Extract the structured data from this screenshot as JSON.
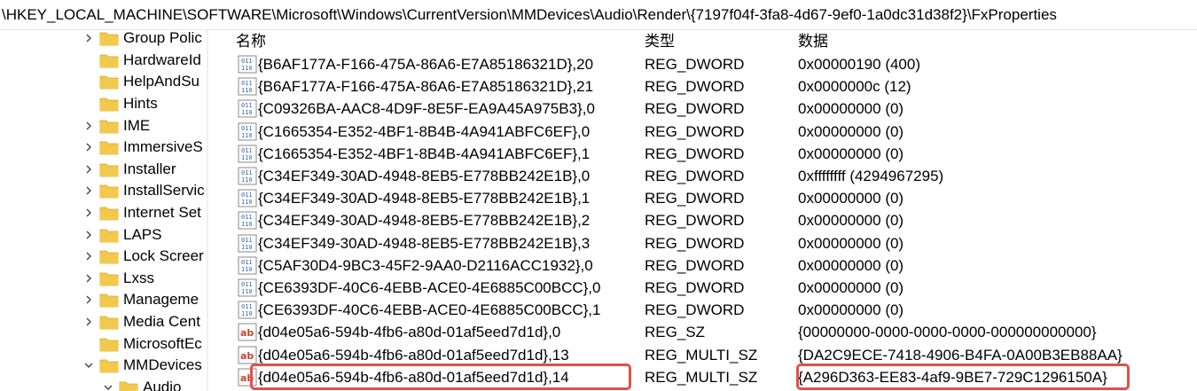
{
  "address": "\\HKEY_LOCAL_MACHINE\\SOFTWARE\\Microsoft\\Windows\\CurrentVersion\\MMDevices\\Audio\\Render\\{7197f04f-3fa8-4d67-9ef0-1a0dc31d38f2}\\FxProperties",
  "tree": {
    "items": [
      {
        "label": "Group Polic",
        "expander": "collapsed"
      },
      {
        "label": "HardwareId",
        "expander": "none"
      },
      {
        "label": "HelpAndSu",
        "expander": "none"
      },
      {
        "label": "Hints",
        "expander": "none"
      },
      {
        "label": "IME",
        "expander": "collapsed"
      },
      {
        "label": "ImmersiveS",
        "expander": "collapsed"
      },
      {
        "label": "Installer",
        "expander": "collapsed"
      },
      {
        "label": "InstallServic",
        "expander": "collapsed"
      },
      {
        "label": "Internet Set",
        "expander": "collapsed"
      },
      {
        "label": "LAPS",
        "expander": "collapsed"
      },
      {
        "label": "Lock Screer",
        "expander": "collapsed"
      },
      {
        "label": "Lxss",
        "expander": "collapsed"
      },
      {
        "label": "Manageme",
        "expander": "collapsed"
      },
      {
        "label": "Media Cent",
        "expander": "collapsed"
      },
      {
        "label": "MicrosoftEc",
        "expander": "none"
      },
      {
        "label": "MMDevices",
        "expander": "expanded"
      },
      {
        "label": "Audio",
        "expander": "expanded"
      }
    ]
  },
  "columns": {
    "name": "名称",
    "type": "类型",
    "data": "数据"
  },
  "rows": [
    {
      "icon": "binary-value-icon",
      "name": "{B6AF177A-F166-475A-86A6-E7A85186321D},20",
      "type": "REG_DWORD",
      "data": "0x00000190 (400)"
    },
    {
      "icon": "binary-value-icon",
      "name": "{B6AF177A-F166-475A-86A6-E7A85186321D},21",
      "type": "REG_DWORD",
      "data": "0x0000000c (12)"
    },
    {
      "icon": "binary-value-icon",
      "name": "{C09326BA-AAC8-4D9F-8E5F-EA9A45A975B3},0",
      "type": "REG_DWORD",
      "data": "0x00000000 (0)"
    },
    {
      "icon": "binary-value-icon",
      "name": "{C1665354-E352-4BF1-8B4B-4A941ABFC6EF},0",
      "type": "REG_DWORD",
      "data": "0x00000000 (0)"
    },
    {
      "icon": "binary-value-icon",
      "name": "{C1665354-E352-4BF1-8B4B-4A941ABFC6EF},1",
      "type": "REG_DWORD",
      "data": "0x00000000 (0)"
    },
    {
      "icon": "binary-value-icon",
      "name": "{C34EF349-30AD-4948-8EB5-E778BB242E1B},0",
      "type": "REG_DWORD",
      "data": "0xffffffff (4294967295)"
    },
    {
      "icon": "binary-value-icon",
      "name": "{C34EF349-30AD-4948-8EB5-E778BB242E1B},1",
      "type": "REG_DWORD",
      "data": "0x00000000 (0)"
    },
    {
      "icon": "binary-value-icon",
      "name": "{C34EF349-30AD-4948-8EB5-E778BB242E1B},2",
      "type": "REG_DWORD",
      "data": "0x00000000 (0)"
    },
    {
      "icon": "binary-value-icon",
      "name": "{C34EF349-30AD-4948-8EB5-E778BB242E1B},3",
      "type": "REG_DWORD",
      "data": "0x00000000 (0)"
    },
    {
      "icon": "binary-value-icon",
      "name": "{C5AF30D4-9BC3-45F2-9AA0-D2116ACC1932},0",
      "type": "REG_DWORD",
      "data": "0x00000000 (0)"
    },
    {
      "icon": "binary-value-icon",
      "name": "{CE6393DF-40C6-4EBB-ACE0-4E6885C00BCC},0",
      "type": "REG_DWORD",
      "data": "0x00000000 (0)"
    },
    {
      "icon": "binary-value-icon",
      "name": "{CE6393DF-40C6-4EBB-ACE0-4E6885C00BCC},1",
      "type": "REG_DWORD",
      "data": "0x00000000 (0)"
    },
    {
      "icon": "string-value-icon",
      "name": "{d04e05a6-594b-4fb6-a80d-01af5eed7d1d},0",
      "type": "REG_SZ",
      "data": "{00000000-0000-0000-0000-000000000000}"
    },
    {
      "icon": "string-value-icon",
      "name": "{d04e05a6-594b-4fb6-a80d-01af5eed7d1d},13",
      "type": "REG_MULTI_SZ",
      "data": "{DA2C9ECE-7418-4906-B4FA-0A00B3EB88AA}"
    },
    {
      "icon": "string-value-icon",
      "name": "{d04e05a6-594b-4fb6-a80d-01af5eed7d1d},14",
      "type": "REG_MULTI_SZ",
      "data": "{A296D363-EE83-4af9-9BE7-729C1296150A}",
      "highlighted": true
    }
  ],
  "colors": {
    "highlight": "#e0504a",
    "folder": "#f2c94c",
    "icon_blue": "#2f6db5",
    "icon_red": "#c8442f"
  }
}
